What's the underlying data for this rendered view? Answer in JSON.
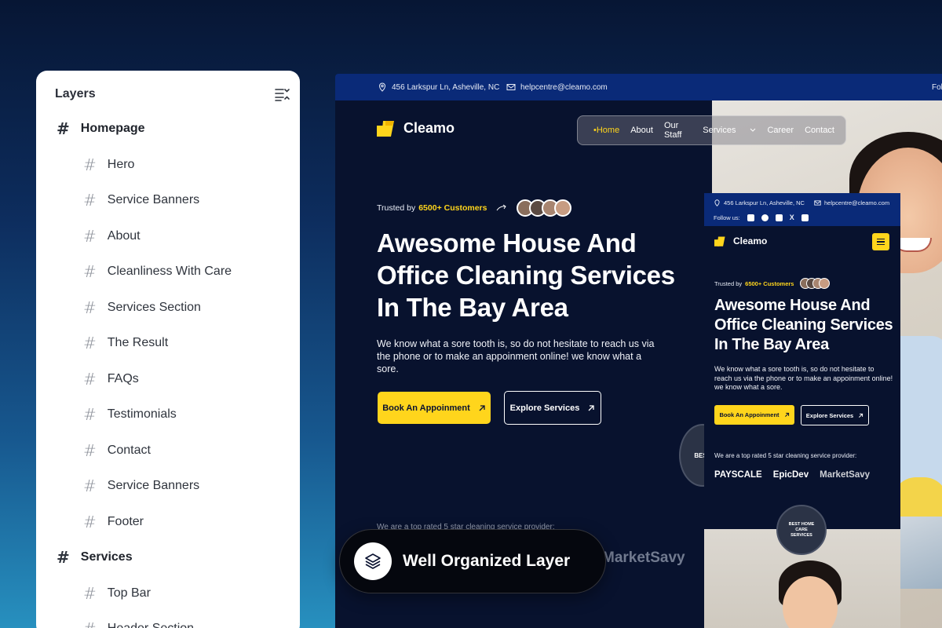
{
  "layers": {
    "title": "Layers",
    "items": [
      {
        "label": "Homepage",
        "level": "parent"
      },
      {
        "label": "Hero",
        "level": "child"
      },
      {
        "label": "Service Banners",
        "level": "child"
      },
      {
        "label": "About",
        "level": "child"
      },
      {
        "label": "Cleanliness With Care",
        "level": "child"
      },
      {
        "label": "Services Section",
        "level": "child"
      },
      {
        "label": "The Result",
        "level": "child"
      },
      {
        "label": "FAQs",
        "level": "child"
      },
      {
        "label": "Testimonials",
        "level": "child"
      },
      {
        "label": "Contact",
        "level": "child"
      },
      {
        "label": "Service Banners",
        "level": "child"
      },
      {
        "label": "Footer",
        "level": "child"
      },
      {
        "label": "Services",
        "level": "parent"
      },
      {
        "label": "Top Bar",
        "level": "child"
      },
      {
        "label": "Header Section",
        "level": "child"
      }
    ]
  },
  "desktop": {
    "topbar": {
      "address": "456 Larkspur Ln, Asheville, NC",
      "email": "helpcentre@cleamo.com",
      "follow": "Fol"
    },
    "logo": "Cleamo",
    "nav": {
      "home": "•Home",
      "about": "About",
      "staff": "Our Staff",
      "services": "Services",
      "career": "Career",
      "contact": "Contact"
    },
    "trusted_prefix": "Trusted by",
    "trusted_count": "6500+ Customers",
    "headline": "Awesome House And Office Cleaning Services In The Bay Area",
    "description": "We know what a sore tooth is, so do not hesitate to reach us via the phone or to make an appoinment online! we know what a sore.",
    "cta_primary": "Book An Appoinment",
    "cta_secondary": "Explore Services",
    "badge": "BEST",
    "partners_blur": "We are a top rated 5 star cleaning service provider:",
    "partner_marketsavy": "MarketSavy"
  },
  "mobile": {
    "address": "456 Larkspur Ln, Asheville, NC",
    "email": "helpcentre@cleamo.com",
    "follow": "Follow us:",
    "logo": "Cleamo",
    "trusted_prefix": "Trusted by",
    "trusted_count": "6500+ Customers",
    "headline": "Awesome House And Office Cleaning Services In The Bay Area",
    "description": "We know what a sore tooth is, so do not hesitate to reach us via the phone or to make an appoinment online! we know what a sore.",
    "cta_primary": "Book An Appoinment",
    "cta_secondary": "Explore Services",
    "rated": "We are a top rated 5 star cleaning service provider:",
    "partners": [
      "PAYSCALE",
      "EpicDev",
      "MarketSavy"
    ],
    "badge": "BEST HOME CARE SERVICES"
  },
  "floating": {
    "label": "Well Organized Layer"
  },
  "colors": {
    "accent": "#ffd51c",
    "navy": "#08122e",
    "topbar": "#0a2a78"
  }
}
